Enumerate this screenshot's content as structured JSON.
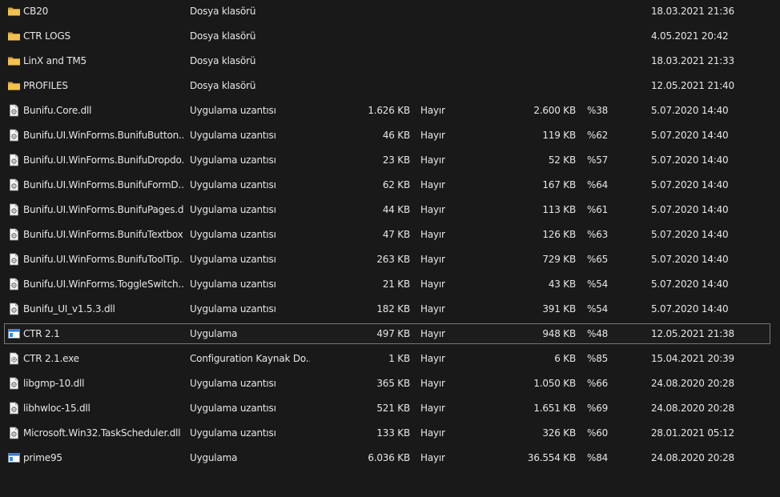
{
  "colors": {
    "background": "#191919",
    "text": "#e6e6e6",
    "folder": "#e8b44a",
    "selection_border": "#777777"
  },
  "files": [
    {
      "icon": "folder-icon",
      "name": "CB20",
      "type": "Dosya klasörü",
      "csize": "",
      "prot": "",
      "size": "",
      "ratio": "",
      "date": "18.03.2021 21:36"
    },
    {
      "icon": "folder-icon",
      "name": "CTR LOGS",
      "type": "Dosya klasörü",
      "csize": "",
      "prot": "",
      "size": "",
      "ratio": "",
      "date": "4.05.2021 20:42"
    },
    {
      "icon": "folder-icon",
      "name": "LinX and TM5",
      "type": "Dosya klasörü",
      "csize": "",
      "prot": "",
      "size": "",
      "ratio": "",
      "date": "18.03.2021 21:33"
    },
    {
      "icon": "folder-icon",
      "name": "PROFILES",
      "type": "Dosya klasörü",
      "csize": "",
      "prot": "",
      "size": "",
      "ratio": "",
      "date": "12.05.2021 21:40"
    },
    {
      "icon": "dll-file-icon",
      "name": "Bunifu.Core.dll",
      "type": "Uygulama uzantısı",
      "csize": "1.626 KB",
      "prot": "Hayır",
      "size": "2.600 KB",
      "ratio": "%38",
      "date": "5.07.2020 14:40"
    },
    {
      "icon": "dll-file-icon",
      "name": "Bunifu.UI.WinForms.BunifuButton....",
      "type": "Uygulama uzantısı",
      "csize": "46 KB",
      "prot": "Hayır",
      "size": "119 KB",
      "ratio": "%62",
      "date": "5.07.2020 14:40"
    },
    {
      "icon": "dll-file-icon",
      "name": "Bunifu.UI.WinForms.BunifuDropdo...",
      "type": "Uygulama uzantısı",
      "csize": "23 KB",
      "prot": "Hayır",
      "size": "52 KB",
      "ratio": "%57",
      "date": "5.07.2020 14:40"
    },
    {
      "icon": "dll-file-icon",
      "name": "Bunifu.UI.WinForms.BunifuFormD...",
      "type": "Uygulama uzantısı",
      "csize": "62 KB",
      "prot": "Hayır",
      "size": "167 KB",
      "ratio": "%64",
      "date": "5.07.2020 14:40"
    },
    {
      "icon": "dll-file-icon",
      "name": "Bunifu.UI.WinForms.BunifuPages.dll",
      "type": "Uygulama uzantısı",
      "csize": "44 KB",
      "prot": "Hayır",
      "size": "113 KB",
      "ratio": "%61",
      "date": "5.07.2020 14:40"
    },
    {
      "icon": "dll-file-icon",
      "name": "Bunifu.UI.WinForms.BunifuTextbox...",
      "type": "Uygulama uzantısı",
      "csize": "47 KB",
      "prot": "Hayır",
      "size": "126 KB",
      "ratio": "%63",
      "date": "5.07.2020 14:40"
    },
    {
      "icon": "dll-file-icon",
      "name": "Bunifu.UI.WinForms.BunifuToolTip....",
      "type": "Uygulama uzantısı",
      "csize": "263 KB",
      "prot": "Hayır",
      "size": "729 KB",
      "ratio": "%65",
      "date": "5.07.2020 14:40"
    },
    {
      "icon": "dll-file-icon",
      "name": "Bunifu.UI.WinForms.ToggleSwitch....",
      "type": "Uygulama uzantısı",
      "csize": "21 KB",
      "prot": "Hayır",
      "size": "43 KB",
      "ratio": "%54",
      "date": "5.07.2020 14:40"
    },
    {
      "icon": "dll-file-icon",
      "name": "Bunifu_UI_v1.5.3.dll",
      "type": "Uygulama uzantısı",
      "csize": "182 KB",
      "prot": "Hayır",
      "size": "391 KB",
      "ratio": "%54",
      "date": "5.07.2020 14:40"
    },
    {
      "icon": "application-icon",
      "name": "CTR 2.1",
      "type": "Uygulama",
      "csize": "497 KB",
      "prot": "Hayır",
      "size": "948 KB",
      "ratio": "%48",
      "date": "12.05.2021 21:38",
      "selected": true
    },
    {
      "icon": "config-file-icon",
      "name": "CTR 2.1.exe",
      "type": "Configuration Kaynak Do...",
      "csize": "1 KB",
      "prot": "Hayır",
      "size": "6 KB",
      "ratio": "%85",
      "date": "15.04.2021 20:39"
    },
    {
      "icon": "dll-file-icon",
      "name": "libgmp-10.dll",
      "type": "Uygulama uzantısı",
      "csize": "365 KB",
      "prot": "Hayır",
      "size": "1.050 KB",
      "ratio": "%66",
      "date": "24.08.2020 20:28"
    },
    {
      "icon": "dll-file-icon",
      "name": "libhwloc-15.dll",
      "type": "Uygulama uzantısı",
      "csize": "521 KB",
      "prot": "Hayır",
      "size": "1.651 KB",
      "ratio": "%69",
      "date": "24.08.2020 20:28"
    },
    {
      "icon": "dll-file-icon",
      "name": "Microsoft.Win32.TaskScheduler.dll",
      "type": "Uygulama uzantısı",
      "csize": "133 KB",
      "prot": "Hayır",
      "size": "326 KB",
      "ratio": "%60",
      "date": "28.01.2021 05:12"
    },
    {
      "icon": "application-icon",
      "name": "prime95",
      "type": "Uygulama",
      "csize": "6.036 KB",
      "prot": "Hayır",
      "size": "36.554 KB",
      "ratio": "%84",
      "date": "24.08.2020 20:28"
    }
  ]
}
